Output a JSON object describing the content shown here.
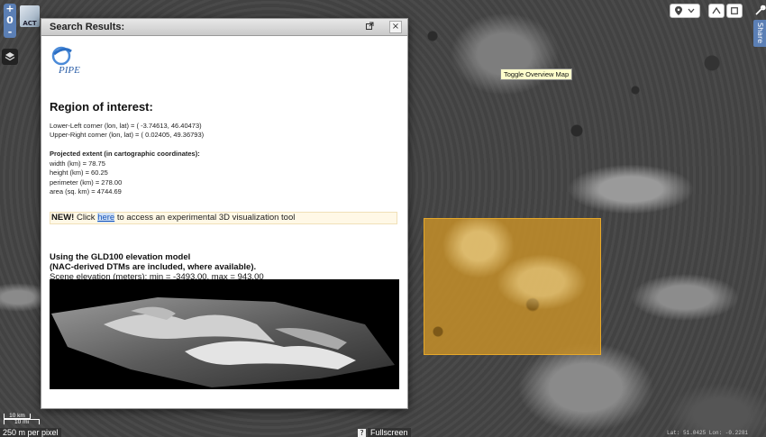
{
  "map": {
    "zoom_in": "+",
    "zoom_level": "0",
    "zoom_out": "-",
    "logo_text": "ACT",
    "tooltip": "Toggle Overview Map",
    "share_label": "Share",
    "scale_km": "10 km",
    "scale_mi": "10 mi",
    "resolution": "250 m per pixel",
    "help_label": "?",
    "fullscreen_label": "Fullscreen",
    "coords": "Lat: 51.0425    Lon: -0.2281",
    "roi_overlay_color": "#c48e28"
  },
  "dialog": {
    "title": "Search Results:",
    "close_label": "×",
    "logo_text": "PIPE",
    "region_heading": "Region of interest:",
    "lower_left": "Lower-Left corner (lon, lat) = ( -3.74613, 46.40473)",
    "upper_right": "Upper-Right corner (lon, lat) = ( 0.02405, 49.36793)",
    "extent_heading": "Projected extent (in cartographic coordinates):",
    "width": "width (km) = 78.75",
    "height": "height (km) = 60.25",
    "perimeter": "perimeter (km) = 278.00",
    "area": "area (sq. km) = 4744.69",
    "new_label": "NEW!",
    "new_pre": " Click ",
    "new_link": "here",
    "new_post": " to access an experimental 3D visualization tool",
    "gld_line1": "Using the GLD100 elevation model",
    "gld_line2": "(NAC-derived DTMs are included, where available).",
    "elevation_line": "Scene elevation (meters): min = -3493.00, max = 943.00"
  },
  "toolbar": {
    "pin_icon": "map-pin-icon",
    "dropdown_icon": "chevron-down-icon",
    "measure_icon": "angle-icon",
    "box_icon": "square-icon",
    "settings_icon": "wrench-icon"
  }
}
